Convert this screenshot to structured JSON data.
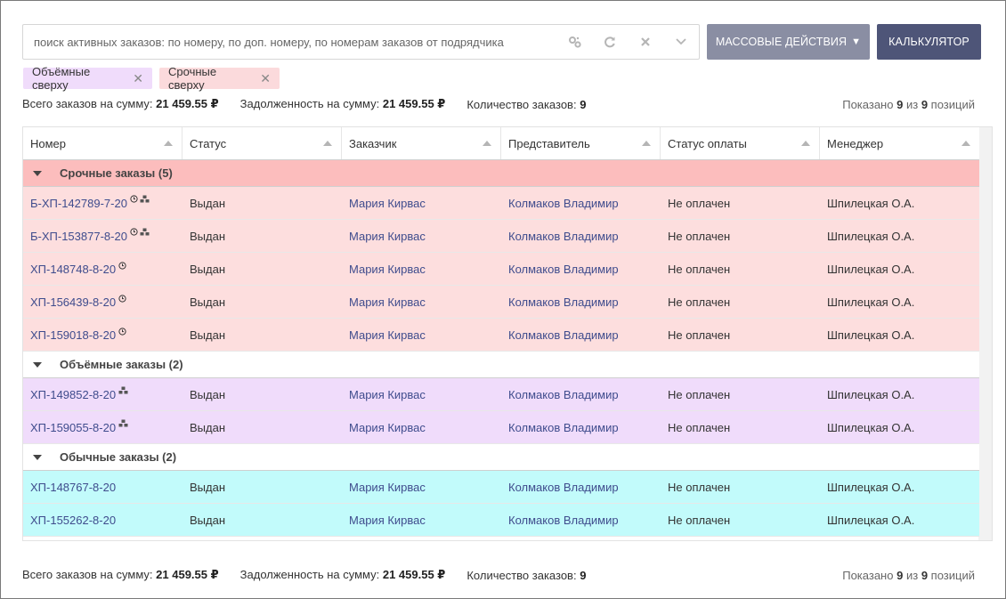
{
  "search": {
    "placeholder": "поиск активных заказов: по номеру, по доп. номеру, по номерам заказов от подрядчика",
    "icons": [
      "settings-icon",
      "refresh-icon",
      "clear-icon",
      "chevron-down-icon"
    ]
  },
  "buttons": {
    "mass_actions": "МАССОВЫЕ ДЕЙСТВИЯ",
    "mass_actions_caret": "▼",
    "calculator": "КАЛЬКУЛЯТОР"
  },
  "filters": [
    {
      "label": "Объёмные сверху",
      "color": "#f0dcfb"
    },
    {
      "label": "Срочные сверху",
      "color": "#fbdadc"
    }
  ],
  "summary": {
    "total_label": "Всего заказов на сумму:",
    "total_value": "21 459.55 ₽",
    "debt_label": "Задолженность на сумму:",
    "debt_value": "21 459.55 ₽",
    "count_label": "Количество заказов:",
    "count_value": "9",
    "shown_prefix": "Показано",
    "shown_count": "9",
    "shown_mid": "из",
    "shown_total": "9",
    "shown_suffix": "позиций"
  },
  "columns": [
    "Номер",
    "Статус",
    "Заказчик",
    "Представитель",
    "Статус оплаты",
    "Менеджер"
  ],
  "groups": [
    {
      "title": "Срочные заказы (5)",
      "color": "#fcbdbd",
      "row_color": "#fddede",
      "rows": [
        {
          "number": "Б-ХП-142789-7-20",
          "icons": [
            "clock-icon",
            "boxes-icon"
          ],
          "status": "Выдан",
          "customer": "Мария Кирвас",
          "rep": "Колмаков Владимир",
          "payment": "Не оплачен",
          "manager": "Шпилецкая О.А."
        },
        {
          "number": "Б-ХП-153877-8-20",
          "icons": [
            "clock-icon",
            "boxes-icon"
          ],
          "status": "Выдан",
          "customer": "Мария Кирвас",
          "rep": "Колмаков Владимир",
          "payment": "Не оплачен",
          "manager": "Шпилецкая О.А."
        },
        {
          "number": "ХП-148748-8-20",
          "icons": [
            "clock-icon"
          ],
          "status": "Выдан",
          "customer": "Мария Кирвас",
          "rep": "Колмаков Владимир",
          "payment": "Не оплачен",
          "manager": "Шпилецкая О.А."
        },
        {
          "number": "ХП-156439-8-20",
          "icons": [
            "clock-icon"
          ],
          "status": "Выдан",
          "customer": "Мария Кирвас",
          "rep": "Колмаков Владимир",
          "payment": "Не оплачен",
          "manager": "Шпилецкая О.А."
        },
        {
          "number": "ХП-159018-8-20",
          "icons": [
            "clock-icon"
          ],
          "status": "Выдан",
          "customer": "Мария Кирвас",
          "rep": "Колмаков Владимир",
          "payment": "Не оплачен",
          "manager": "Шпилецкая О.А."
        }
      ]
    },
    {
      "title": "Объёмные заказы (2)",
      "color": "#ffffff",
      "row_color": "#f0dcfb",
      "rows": [
        {
          "number": "ХП-149852-8-20",
          "icons": [
            "boxes-icon"
          ],
          "status": "Выдан",
          "customer": "Мария Кирвас",
          "rep": "Колмаков Владимир",
          "payment": "Не оплачен",
          "manager": "Шпилецкая О.А."
        },
        {
          "number": "ХП-159055-8-20",
          "icons": [
            "boxes-icon"
          ],
          "status": "Выдан",
          "customer": "Мария Кирвас",
          "rep": "Колмаков Владимир",
          "payment": "Не оплачен",
          "manager": "Шпилецкая О.А."
        }
      ]
    },
    {
      "title": "Обычные заказы (2)",
      "color": "#ffffff",
      "row_color": "#c2fbfb",
      "rows": [
        {
          "number": "ХП-148767-8-20",
          "icons": [],
          "status": "Выдан",
          "customer": "Мария Кирвас",
          "rep": "Колмаков Владимир",
          "payment": "Не оплачен",
          "manager": "Шпилецкая О.А."
        },
        {
          "number": "ХП-155262-8-20",
          "icons": [],
          "status": "Выдан",
          "customer": "Мария Кирвас",
          "rep": "Колмаков Владимир",
          "payment": "Не оплачен",
          "manager": "Шпилецкая О.А."
        }
      ]
    }
  ]
}
